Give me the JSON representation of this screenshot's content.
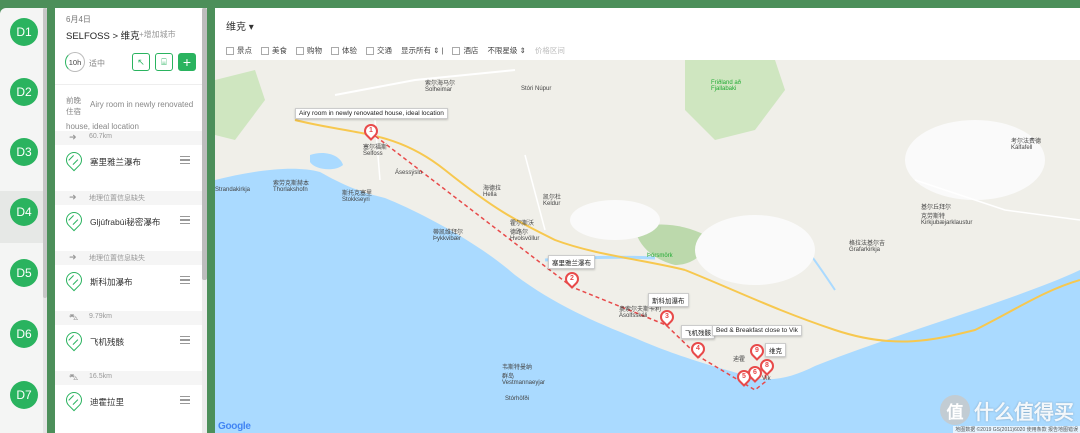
{
  "days": [
    "D1",
    "D2",
    "D3",
    "D4",
    "D5",
    "D6",
    "D7"
  ],
  "itinerary": {
    "date": "6月4日",
    "route": "SELFOSS > 维克",
    "add_city": "+增加城市",
    "hours": "10h",
    "pace": "适中",
    "prev_night_label_1": "前晚",
    "prev_night_label_2": "住宿",
    "lodging_line_1": "Airy room in newly renovated",
    "lodging_line_2": "house, ideal location",
    "rows": [
      {
        "kind": "dist",
        "icon": "arrow-right-icon",
        "text": "60.7km"
      },
      {
        "kind": "item",
        "name": "塞里雅兰瀑布"
      },
      {
        "kind": "dist",
        "icon": "arrow-right-icon",
        "text": "地理位置信息缺失"
      },
      {
        "kind": "item",
        "name": "Gljúfrabúi秘密瀑布"
      },
      {
        "kind": "dist",
        "icon": "arrow-right-icon",
        "text": "地理位置信息缺失"
      },
      {
        "kind": "item",
        "name": "斯科加瀑布"
      },
      {
        "kind": "dist",
        "icon": "car-icon",
        "text": "9.79km"
      },
      {
        "kind": "item",
        "name": "飞机残骸"
      },
      {
        "kind": "dist",
        "icon": "car-icon",
        "text": "16.5km"
      },
      {
        "kind": "item",
        "name": "迪霍拉里"
      }
    ]
  },
  "map": {
    "city": "维克",
    "filters": [
      "景点",
      "美食",
      "购物",
      "体验",
      "交通"
    ],
    "display_select": "显示所有",
    "hotel": "酒店",
    "star_select": "不限星级",
    "faded_option": "价格区间",
    "tooltip_1": "Airy room in newly renovated house, ideal location",
    "tooltip_2": "塞里雅兰瀑布",
    "tooltip_3": "斯科加瀑布",
    "tooltip_4a": "飞机残骸",
    "tooltip_4b": "Bed & Breakfast close to Vik",
    "tooltip_9": "维克",
    "markers": [
      "1",
      "2",
      "3",
      "4",
      "9",
      "8",
      "6",
      "5"
    ],
    "labels": {
      "selfoss": "塞尔福斯\nSelfoss",
      "thorlakshofn": "索劳克斯赫本\nThorlakshofn",
      "stokkseyri": "斯托克塞里\nStokkseyri",
      "hella": "海德拉\nHella",
      "hvolsvollur": "霍尔斯沃\n德路尔\nHvolsvöllur",
      "keldur": "凯尔杜\nKeldur",
      "thykkvibaer": "蒂凯维拜尔\nÞykkvibær",
      "asolfsskali": "奥索尔夫斯卡利\nÁsolfsskáli",
      "vestmannaeyjar": "韦斯特曼纳\n群岛\nVestmannaeyjar",
      "stortofel": "Stórhöfði",
      "fridland": "Friðland að\nFjallabaki",
      "thorsmork": "Þórsmörk",
      "kalfafell": "考尔法费德\nKálfafell",
      "kirkjubaer": "基尔丘拜尔\n克劳斯特\nKirkjubæjarklaustur",
      "grafarkirkja": "格拉法基尔吉\nGrafarkirkja",
      "solheimar": "索尔海马尔\nSolheimar",
      "strandakirkja": "Strandakirkja",
      "aspessyslu": "Ásessýslu",
      "storinupur": "Stóri Núpur",
      "vik": "Vík",
      "dyrholaey": "迪霍"
    },
    "google": "Google",
    "copyright": "地图数据 ©2019 GS(2011)6020   使用条款   报告地图错误"
  },
  "watermark": {
    "logo": "值",
    "text": "什么值得买"
  },
  "colors": {
    "accent": "#2ab35f",
    "route": "#e84a4a",
    "sea": "#aadaff",
    "land": "#f0efe9"
  }
}
